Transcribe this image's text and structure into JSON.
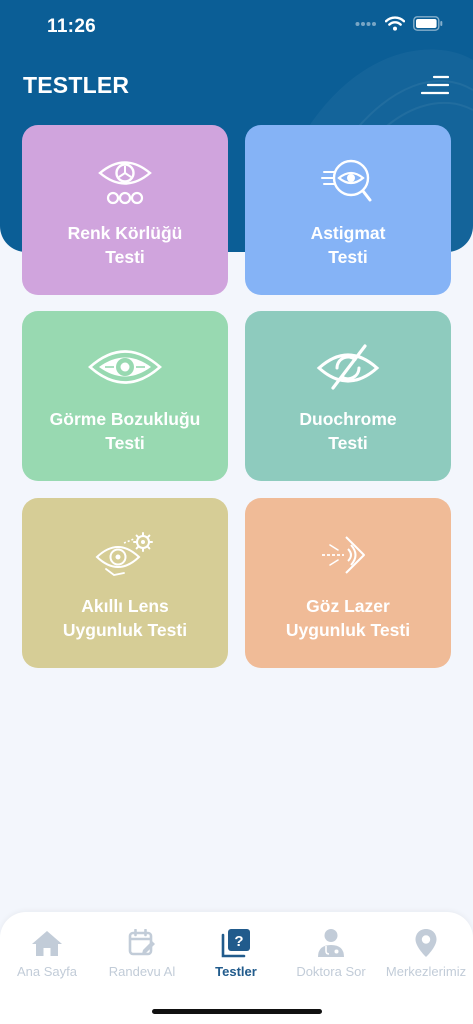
{
  "status": {
    "time": "11:26"
  },
  "header": {
    "title": "TESTLER"
  },
  "cards": [
    {
      "line1": "Renk Körlüğü",
      "line2": "Testi",
      "icon": "eye-dots-icon",
      "color": "#d0a4dd"
    },
    {
      "line1": "Astigmat",
      "line2": "Testi",
      "icon": "astigmatism-eye-icon",
      "color": "#85b3f6"
    },
    {
      "line1": "Görme Bozukluğu",
      "line2": "Testi",
      "icon": "eye-icon",
      "color": "#98d9b1"
    },
    {
      "line1": "Duochrome",
      "line2": "Testi",
      "icon": "eye-slash-icon",
      "color": "#8ecbbe"
    },
    {
      "line1": "Akıllı Lens",
      "line2": "Uygunluk Testi",
      "icon": "eye-gear-icon",
      "color": "#d6cd96"
    },
    {
      "line1": "Göz Lazer",
      "line2": "Uygunluk Testi",
      "icon": "laser-eye-icon",
      "color": "#f0bb97"
    }
  ],
  "tabs": [
    {
      "label": "Ana Sayfa",
      "icon": "home-icon"
    },
    {
      "label": "Randevu Al",
      "icon": "calendar-edit-icon"
    },
    {
      "label": "Testler",
      "icon": "question-book-icon",
      "active": true
    },
    {
      "label": "Doktora Sor",
      "icon": "doctor-icon"
    },
    {
      "label": "Merkezlerimiz",
      "icon": "location-pin-icon"
    }
  ],
  "colors": {
    "header": "#0b5e96",
    "active_tab": "#215b8c",
    "inactive_tab": "#c2ccd8"
  }
}
